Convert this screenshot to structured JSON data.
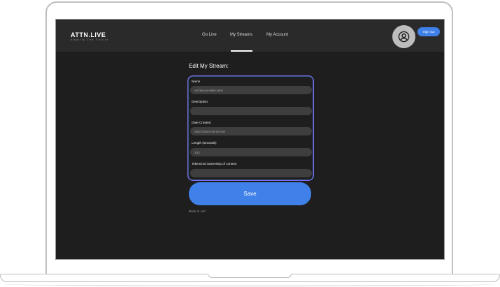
{
  "header": {
    "brand": "ATTN.LIVE",
    "tagline": "Amplify The Future",
    "nav": [
      "Go Live",
      "My Streams",
      "My Account"
    ],
    "active_nav": "My Streams",
    "sign_out_label": "Sign out",
    "avatar_icon": "user-circle-icon"
  },
  "form": {
    "title": "Edit My Stream:",
    "fields": [
      {
        "label": "Name",
        "value": "mchka-ya-lalse-alno",
        "placeholder": ""
      },
      {
        "label": "Description",
        "value": "",
        "placeholder": ""
      },
      {
        "label": "Date Created",
        "value": "06/27/2024 06:25 AM",
        "placeholder": ""
      },
      {
        "label": "Length (seconds)",
        "value": "142",
        "placeholder": ""
      },
      {
        "label": "Tokenized ownership of content",
        "value": "",
        "placeholder": ""
      }
    ],
    "save_label": "Save",
    "back_label": "Back to List"
  },
  "colors": {
    "accent": "#3f81e8",
    "card_border": "#7b6cf0",
    "background": "#1e1e1e",
    "header_bg": "#2a2a2a"
  }
}
